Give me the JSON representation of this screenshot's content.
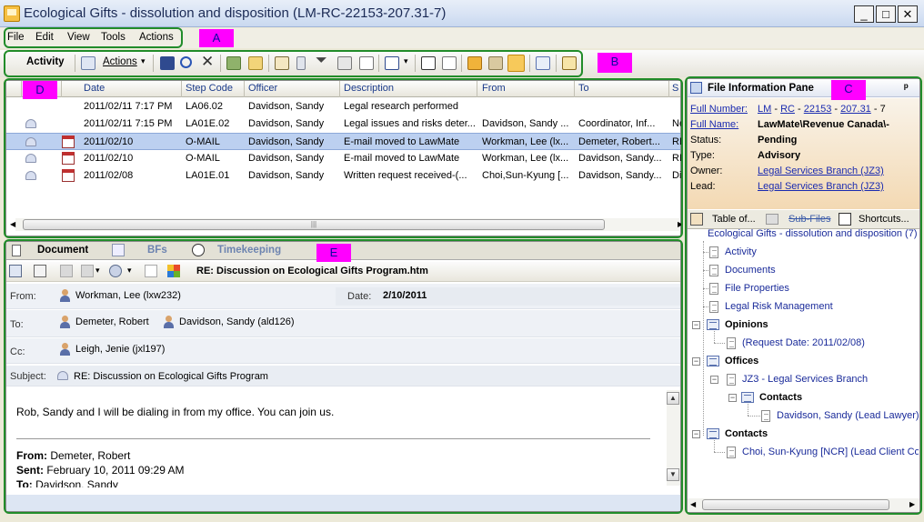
{
  "window": {
    "title": "Ecological Gifts - dissolution and disposition (LM-RC-22153-207.31-7)",
    "minimize": "_",
    "maximize": "□",
    "close": "✕"
  },
  "menu": {
    "items": [
      {
        "label": "File"
      },
      {
        "label": "Edit"
      },
      {
        "label": "View"
      },
      {
        "label": "Tools"
      },
      {
        "label": "Actions"
      }
    ]
  },
  "toolbar": {
    "activity_label": "Activity",
    "actions_label": "Actions",
    "dropdown_glyph": "▾"
  },
  "annotations": {
    "a": "A",
    "b": "B",
    "c": "C",
    "d": "D",
    "e": "E"
  },
  "grid": {
    "columns": [
      "Date",
      "Step Code",
      "Officer",
      "Description",
      "From",
      "To",
      "S"
    ],
    "rows": [
      {
        "date": "2011/02/11 7:17 PM",
        "step": "LA06.02",
        "officer": "Davidson, Sandy",
        "desc": "Legal research performed",
        "from": "",
        "to": "",
        "extra": "",
        "mail": false,
        "cal": false,
        "selected": false
      },
      {
        "date": "2011/02/11 7:15 PM",
        "step": "LA01E.02",
        "officer": "Davidson, Sandy",
        "desc": "Legal issues and risks deter...",
        "from": "Davidson, Sandy ...",
        "to": "Coordinator, Inf...",
        "extra": "Ne",
        "mail": true,
        "cal": false,
        "selected": false
      },
      {
        "date": "2011/02/10",
        "step": "O-MAIL",
        "officer": "Davidson, Sandy",
        "desc": "E-mail moved to LawMate",
        "from": "Workman, Lee (lx...",
        "to": "Demeter, Robert...",
        "extra": "RE",
        "mail": true,
        "cal": true,
        "selected": true
      },
      {
        "date": "2011/02/10",
        "step": "O-MAIL",
        "officer": "Davidson, Sandy",
        "desc": "E-mail moved to LawMate",
        "from": "Workman, Lee (lx...",
        "to": "Davidson, Sandy...",
        "extra": "RE",
        "mail": true,
        "cal": true,
        "selected": false
      },
      {
        "date": "2011/02/08",
        "step": "LA01E.01",
        "officer": "Davidson, Sandy",
        "desc": "Written request received-(...",
        "from": "Choi,Sun-Kyung [...",
        "to": "Davidson, Sandy...",
        "extra": "Di",
        "mail": true,
        "cal": true,
        "selected": false
      }
    ]
  },
  "document": {
    "tabs": [
      "Document",
      "BFs",
      "Timekeeping"
    ],
    "filename": "RE: Discussion on  Ecological Gifts Program.htm",
    "from_label": "From:",
    "from_value": "Workman, Lee (lxw232)",
    "date_label": "Date:",
    "date_value": "2/10/2011",
    "to_label": "To:",
    "to_values": [
      "Demeter, Robert",
      "Davidson, Sandy (ald126)"
    ],
    "cc_label": "Cc:",
    "cc_value": "Leigh, Jenie (jxl197)",
    "subject_label": "Subject:",
    "subject_value": "RE: Discussion on  Ecological Gifts Program",
    "body_line": "Rob, Sandy and I will be dialing in from my office.  You can join us.",
    "quoted_from_label": "From:",
    "quoted_from_value": "Demeter, Robert",
    "quoted_sent_label": "Sent:",
    "quoted_sent_value": "February 10, 2011 09:29 AM",
    "quoted_to_label": "To:",
    "quoted_to_value": "Davidson, Sandy"
  },
  "file_info": {
    "title": "File Information Pane",
    "pin": "ᵖ",
    "full_number_label": "Full Number:",
    "full_number_parts": [
      "LM",
      "RC",
      "22153",
      "207.31"
    ],
    "full_number_sep": "-",
    "full_number_tail": "- 7",
    "full_name_label": "Full Name:",
    "full_name_value": "LawMate\\Revenue Canada\\-",
    "status_label": "Status:",
    "status_value": "Pending",
    "type_label": "Type:",
    "type_value": "Advisory",
    "owner_label": "Owner:",
    "owner_value": "Legal Services Branch (JZ3)",
    "lead_label": "Lead:",
    "lead_value": "Legal Services Branch (JZ3)"
  },
  "right_tabs": [
    "Table of...",
    "Sub-Files",
    "Shortcuts..."
  ],
  "tree": {
    "root": "Ecological Gifts - dissolution and disposition (7)",
    "items": [
      "Activity",
      "Documents",
      "File Properties",
      "Legal Risk Management"
    ],
    "opinions": "Opinions",
    "opinion_child": "(Request Date: 2011/02/08)",
    "offices": "Offices",
    "office_child": "JZ3 - Legal Services Branch",
    "office_contacts": "Contacts",
    "office_contact_child": "Davidson, Sandy (Lead Lawyer)",
    "contacts": "Contacts",
    "contact_child": "Choi, Sun-Kyung [NCR] (Lead Client Cor"
  },
  "colors": {
    "accent": "#218c2a",
    "tag": "#ff00ff",
    "selection": "#bcd0f0",
    "link": "#1a2bb0"
  }
}
